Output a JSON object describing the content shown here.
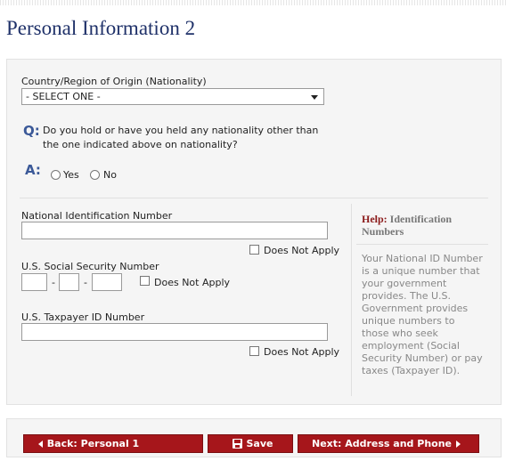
{
  "page": {
    "title": "Personal Information 2"
  },
  "nationality": {
    "label": "Country/Region of Origin (Nationality)",
    "selected": "- SELECT ONE -"
  },
  "question": {
    "q_letter": "Q:",
    "text": "Do you hold or have you held any nationality other than the one indicated above on nationality?",
    "a_letter": "A:",
    "yes_label": "Yes",
    "no_label": "No"
  },
  "national_id": {
    "label": "National Identification Number",
    "value": "",
    "does_not_apply": "Does Not Apply"
  },
  "ssn": {
    "label": "U.S. Social Security Number",
    "part1": "",
    "part2": "",
    "part3": "",
    "separator": "-",
    "does_not_apply": "Does Not Apply"
  },
  "taxpayer_id": {
    "label": "U.S. Taxpayer ID Number",
    "value": "",
    "does_not_apply": "Does Not Apply"
  },
  "help": {
    "lead": "Help:",
    "title": "Identification Numbers",
    "body": "Your National ID Number is a unique number that your government provides. The U.S. Government provides unique numbers to those who seek employment (Social Security Number) or pay taxes (Taxpayer ID)."
  },
  "footer": {
    "back_label": "Back: Personal 1",
    "save_label": "Save",
    "next_label": "Next: Address and Phone"
  },
  "colors": {
    "title": "#1f3169",
    "button": "#a6161b",
    "help_lead": "#8b1a1a",
    "qa": "#3b5998"
  }
}
